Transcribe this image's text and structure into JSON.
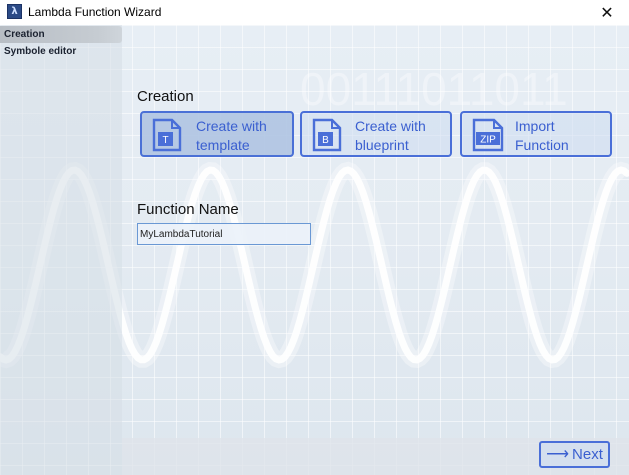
{
  "window": {
    "title": "Lambda Function Wizard",
    "close_glyph": "✕",
    "icon": "lambda-app-icon"
  },
  "sidebar": {
    "items": [
      {
        "label": "Creation",
        "active": true
      },
      {
        "label": "Symbole editor",
        "active": false
      }
    ]
  },
  "creation": {
    "title": "Creation",
    "options": [
      {
        "label": "Create with\ntemplate",
        "badge": "T",
        "selected": true
      },
      {
        "label": "Create with\nblueprint",
        "badge": "B",
        "selected": false
      },
      {
        "label": "Import\nFunction",
        "badge": "ZIP",
        "selected": false
      }
    ]
  },
  "function_name": {
    "title": "Function Name",
    "value": "MyLambdaTutorial"
  },
  "background": {
    "binary_text": "00111011011"
  },
  "footer": {
    "next_label": "Next",
    "next_glyph": "⟶"
  },
  "colors": {
    "accent": "#4a6fd8",
    "accent_text": "#3a5fd0",
    "input_border": "#6a98d4"
  }
}
